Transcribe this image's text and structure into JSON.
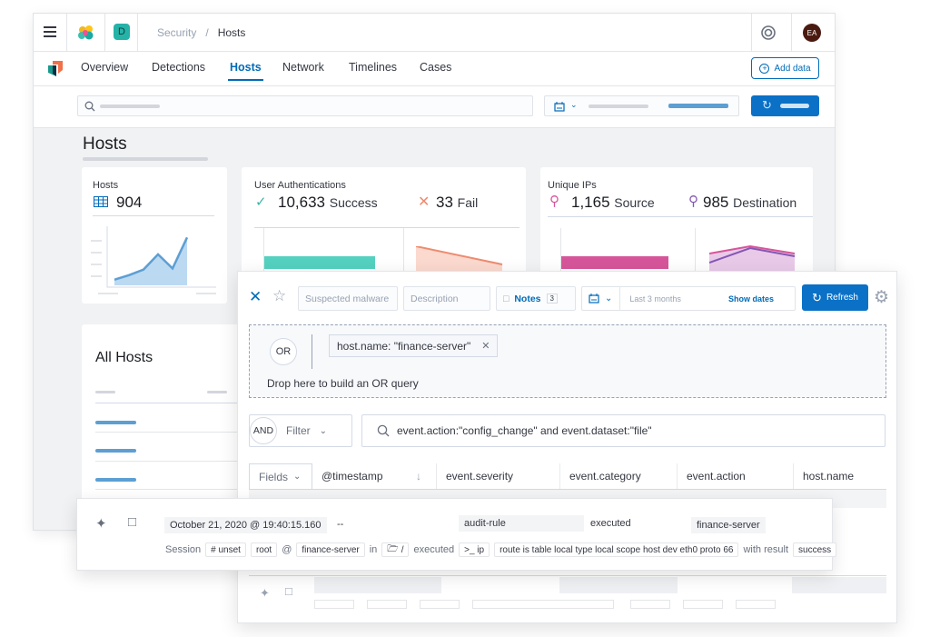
{
  "topbar": {
    "space_letter": "D",
    "breadcrumb": [
      "Security",
      "Hosts"
    ],
    "breadcrumb_sep": "/",
    "avatar_initials": "EA",
    "colors": {
      "space": "#25b3a8",
      "avatar": "#4a1a10",
      "accent": "#006bb8"
    }
  },
  "nav": {
    "tabs": [
      "Overview",
      "Detections",
      "Hosts",
      "Network",
      "Timelines",
      "Cases"
    ],
    "active": "Hosts",
    "add_data_label": "Add data"
  },
  "page": {
    "title": "Hosts",
    "hosts_card": {
      "label": "Hosts",
      "value": "904",
      "trend": [
        0.1,
        0.18,
        0.28,
        0.55,
        0.3,
        0.85
      ]
    },
    "auth_card": {
      "label": "User Authentications",
      "success_value": "10,633",
      "success_label": "Success",
      "fail_value": "33",
      "fail_label": "Fail",
      "bars": [
        {
          "name": "success",
          "value": 1.0,
          "color": "#54d1c0"
        },
        {
          "name": "fail",
          "value": 0.2,
          "color": "#ee8b6f"
        }
      ]
    },
    "ips_card": {
      "label": "Unique IPs",
      "source_value": "1,165",
      "source_label": "Source",
      "dest_value": "985",
      "dest_label": "Destination",
      "bars": [
        {
          "name": "source",
          "value": 1.0,
          "color": "#d6559a"
        },
        {
          "name": "destination",
          "value": 0.65,
          "color": "#8457b3"
        }
      ]
    },
    "all_hosts_title": "All Hosts"
  },
  "timeline": {
    "title_placeholder": "Suspected malware",
    "description_placeholder": "Description",
    "notes_label": "Notes",
    "notes_count": "3",
    "date_range": "Last 3 months",
    "show_dates": "Show dates",
    "refresh_label": "Refresh",
    "or_badge": "OR",
    "or_pill": "host.name: \"finance-server\"",
    "drop_hint": "Drop here to build an OR query",
    "and_badge": "AND",
    "filter_label": "Filter",
    "query": "event.action:\"config_change\" and event.dataset:\"file\"",
    "fields_label": "Fields",
    "columns": [
      "@timestamp",
      "event.severity",
      "event.category",
      "event.action",
      "host.name"
    ]
  },
  "row": {
    "timestamp": "October  21, 2020 @ 19:40:15.160",
    "severity": "--",
    "category": "audit-rule",
    "action": "executed",
    "host": "finance-server",
    "session_label": "Session",
    "session_id": "# unset",
    "user": "root",
    "at": "@",
    "host_chip": "finance-server",
    "in": "in",
    "dir": "/",
    "executed": "executed",
    "process": ">_ ip",
    "args": "route is table local type local scope host dev eth0 proto 66",
    "with_result": "with result",
    "result": "success"
  }
}
